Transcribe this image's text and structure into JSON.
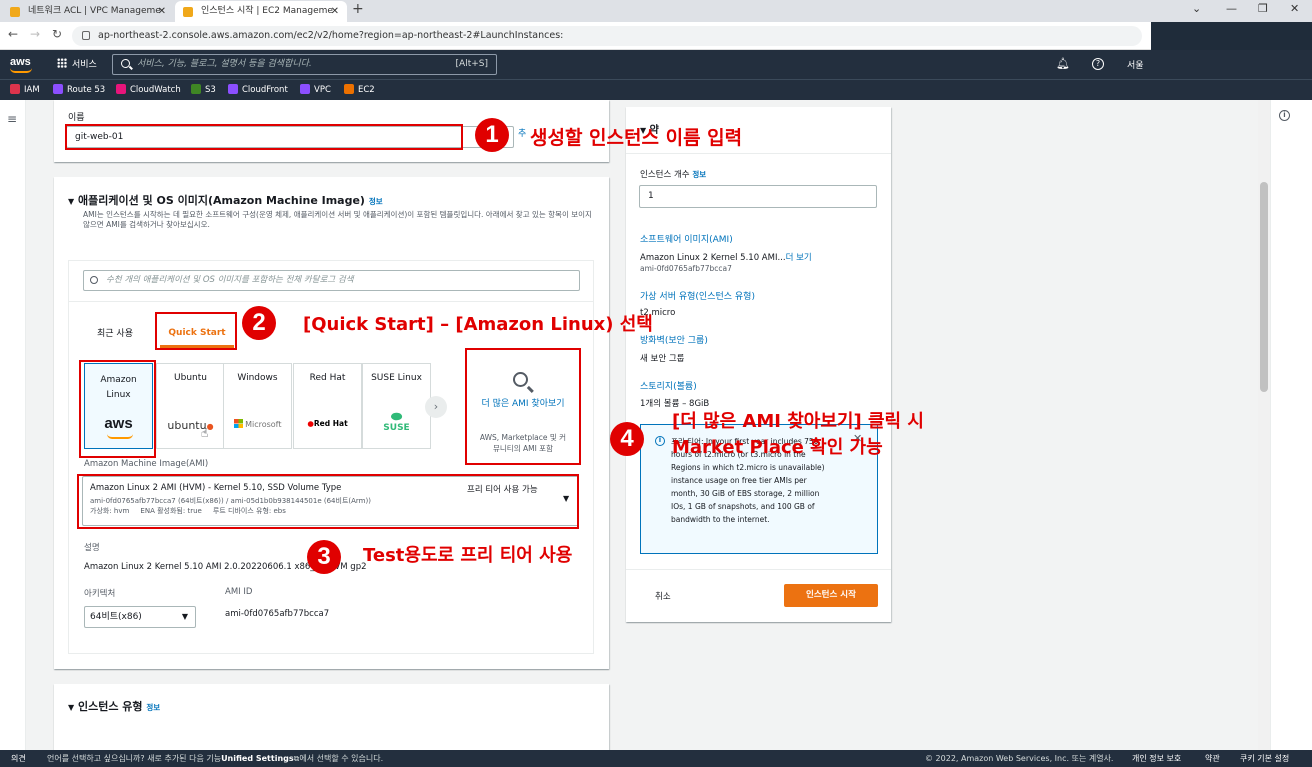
{
  "browser": {
    "tabs": [
      {
        "title": "네트워크 ACL | VPC Manageme",
        "active": false
      },
      {
        "title": "인스턴스 시작 | EC2 Manageme",
        "active": true
      }
    ],
    "new_tab": "+",
    "url": "ap-northeast-2.console.aws.amazon.com/ec2/v2/home?region=ap-northeast-2#LaunchInstances:"
  },
  "aws_nav": {
    "logo": "aws",
    "services_label": "서비스",
    "search_placeholder": "서비스, 기능, 블로그, 설명서 등을 검색합니다.",
    "search_shortcut": "[Alt+S]",
    "region": "서울"
  },
  "favorites": [
    {
      "label": "IAM",
      "color": "#dd344c"
    },
    {
      "label": "Route 53",
      "color": "#8c4fff"
    },
    {
      "label": "CloudWatch",
      "color": "#e7157b"
    },
    {
      "label": "S3",
      "color": "#3f8624"
    },
    {
      "label": "CloudFront",
      "color": "#8c4fff"
    },
    {
      "label": "VPC",
      "color": "#8c4fff"
    },
    {
      "label": "EC2",
      "color": "#ed7100"
    }
  ],
  "name_section": {
    "label": "이름",
    "value": "git-web-01",
    "add_tag_fragment": "추"
  },
  "ami_section": {
    "title": "애플리케이션 및 OS 이미지(Amazon Machine Image)",
    "info": "정보",
    "description": "AMI는 인스턴스를 시작하는 데 필요한 소프트웨어 구성(운영 체제, 애플리케이션 서버 및 애플리케이션)이 포함된 템플릿입니다. 아래에서 찾고 있는 항목이 보이지 않으면 AMI를 검색하거나 찾아보십시오.",
    "search_placeholder": "수천 개의 애플리케이션 및 OS 이미지를 포함하는 전체 카탈로그 검색",
    "tabs": [
      "최근 사용",
      "Quick Start"
    ],
    "tiles": [
      {
        "name": "Amazon Linux",
        "logo": "aws"
      },
      {
        "name": "Ubuntu",
        "logo": "ubuntu"
      },
      {
        "name": "Windows",
        "logo": "Microsoft"
      },
      {
        "name": "Red Hat",
        "logo": "Red Hat"
      },
      {
        "name": "SUSE Linux",
        "logo": "SUSE"
      }
    ],
    "browse_more": {
      "title": "더 많은 AMI 찾아보기",
      "subtitle": "AWS, Marketplace 및 커뮤니티의 AMI 포함"
    },
    "ami_label": "Amazon Machine Image(AMI)",
    "selected_ami": {
      "name": "Amazon Linux 2 AMI (HVM) - Kernel 5.10, SSD Volume Type",
      "ids": "ami-0fd0765afb77bcca7 (64비트(x86)) / ami-05d1b0b938144501e (64비트(Arm))",
      "meta": "가상화: hvm     ENA 활성화됨: true     루트 디바이스 유형: ebs",
      "free_tier": "프리 티어 사용 가능"
    },
    "desc_label": "설명",
    "desc_value": "Amazon Linux 2 Kernel 5.10 AMI 2.0.20220606.1 x86_64 HVM gp2",
    "arch_label": "아키텍처",
    "arch_value": "64비트(x86)",
    "ami_id_label": "AMI ID",
    "ami_id_value": "ami-0fd0765afb77bcca7"
  },
  "instance_type_section": {
    "title": "인스턴스 유형",
    "info": "정보"
  },
  "summary": {
    "header_fragment": "약",
    "count_label": "인스턴스 개수",
    "count_info": "정보",
    "count_value": "1",
    "software_image_label": "소프트웨어 이미지(AMI)",
    "software_image_value": "Amazon Linux 2 Kernel 5.10 AMI...",
    "more_link": "더 보기",
    "software_image_id": "ami-0fd0765afb77bcca7",
    "server_type_label": "가상 서버 유형(인스턴스 유형)",
    "server_type_value": "t2.micro",
    "firewall_label": "방화벽(보안 그룹)",
    "firewall_value": "새 보안 그룹",
    "storage_label": "스토리지(볼륨)",
    "storage_value": "1개의 볼륨 – 8GiB",
    "free_tier_notice": "프리 티어: In your first year includes 750 hours of t2.micro (or t3.micro in the Regions in which t2.micro is unavailable) instance usage on free tier AMIs per month, 30 GiB of EBS storage, 2 million IOs, 1 GB of snapshots, and 100 GB of bandwidth to the internet.",
    "cancel_label": "취소",
    "launch_label": "인스턴스 시작"
  },
  "annotations": [
    {
      "number": "1",
      "text": "생성할 인스턴스 이름 입력"
    },
    {
      "number": "2",
      "text": "[Quick Start] – [Amazon Linux) 선택"
    },
    {
      "number": "3",
      "text": "Test용도로 프리 티어 사용"
    },
    {
      "number": "4",
      "text_line1": "[더 많은 AMI 찾아보기] 클릭 시",
      "text_line2": "Market Place 확인 가능"
    }
  ],
  "footer": {
    "feedback": "의견",
    "language_notice": "언어를 선택하고 싶으십니까? 새로 추가된 다음 기능",
    "unified_settings": "Unified Settings",
    "language_notice_suffix": "에서 선택할 수 있습니다.",
    "copyright": "© 2022, Amazon Web Services, Inc. 또는 계열사.",
    "privacy": "개인 정보 보호",
    "terms": "약관",
    "cookie": "쿠키 기본 설정"
  }
}
